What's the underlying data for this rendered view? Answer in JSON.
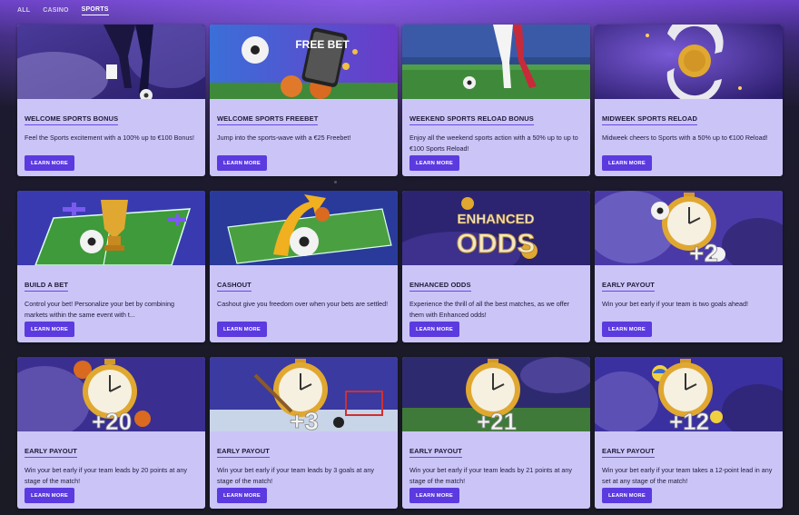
{
  "tabs": [
    {
      "label": "ALL",
      "active": false
    },
    {
      "label": "CASINO",
      "active": false
    },
    {
      "label": "SPORTS",
      "active": true
    }
  ],
  "cards": [
    {
      "title": "WELCOME SPORTS BONUS",
      "desc": "Feel the Sports excitement with a 100% up to €100 Bonus!",
      "button": "LEARN MORE",
      "image": "soccer-kick-banner"
    },
    {
      "title": "WELCOME SPORTS FREEBET",
      "desc": "Jump into the sports-wave with a €25 Freebet!",
      "button": "LEARN MORE",
      "image": "free-bet-phone-banner",
      "image_text": "FREE BET"
    },
    {
      "title": "WEEKEND SPORTS RELOAD BONUS",
      "desc": "Enjoy all the weekend sports action with a 50% up to up to €100 Sports Reload!",
      "button": "LEARN MORE",
      "image": "soccer-stadium-banner"
    },
    {
      "title": "MIDWEEK SPORTS RELOAD",
      "desc": "Midweek cheers to Sports with a 50% up to €100 Reload!",
      "button": "LEARN MORE",
      "image": "reload-arrows-ball-banner"
    },
    {
      "title": "BUILD A BET",
      "desc": "Control your bet! Personalize your bet by combining markets within the same event with t...",
      "button": "LEARN MORE",
      "image": "trophy-pitch-banner"
    },
    {
      "title": "CASHOUT",
      "desc": "Cashout give you freedom over when your bets are settled!",
      "button": "LEARN MORE",
      "image": "cashout-pitch-arrow-banner"
    },
    {
      "title": "ENHANCED ODDS",
      "desc": "Experience the thrill of all the best matches, as we offer them with Enhanced odds!",
      "button": "LEARN MORE",
      "image": "enhanced-odds-banner",
      "image_text_1": "ENHANCED",
      "image_text_2": "ODDS"
    },
    {
      "title": "EARLY PAYOUT",
      "desc": "Win your bet early if your team is two goals ahead!",
      "button": "LEARN MORE",
      "image": "stopwatch-banner",
      "image_text": "+2"
    },
    {
      "title": "EARLY PAYOUT",
      "desc": "Win your bet early if your team leads by 20 points at any stage of the match!",
      "button": "LEARN MORE",
      "image": "stopwatch-basketball-banner",
      "image_text": "+20"
    },
    {
      "title": "EARLY PAYOUT",
      "desc": "Win your bet early if your team leads by 3 goals at any stage of the match!",
      "button": "LEARN MORE",
      "image": "stopwatch-hockey-banner",
      "image_text": "+3"
    },
    {
      "title": "EARLY PAYOUT",
      "desc": "Win your bet early if your team leads by 21 points at any stage of the match!",
      "button": "LEARN MORE",
      "image": "stopwatch-football-banner",
      "image_text": "+21"
    },
    {
      "title": "EARLY PAYOUT",
      "desc": "Win your bet early if your team takes a 12-point lead in any set at any stage of the match!",
      "button": "LEARN MORE",
      "image": "stopwatch-volleyball-banner",
      "image_text": "+12"
    }
  ],
  "colors": {
    "card_bg": "#cbc5f7",
    "button_bg": "#5b3ae0",
    "title_underline": "#6a47e8",
    "page_bg": "#1a1b24"
  }
}
